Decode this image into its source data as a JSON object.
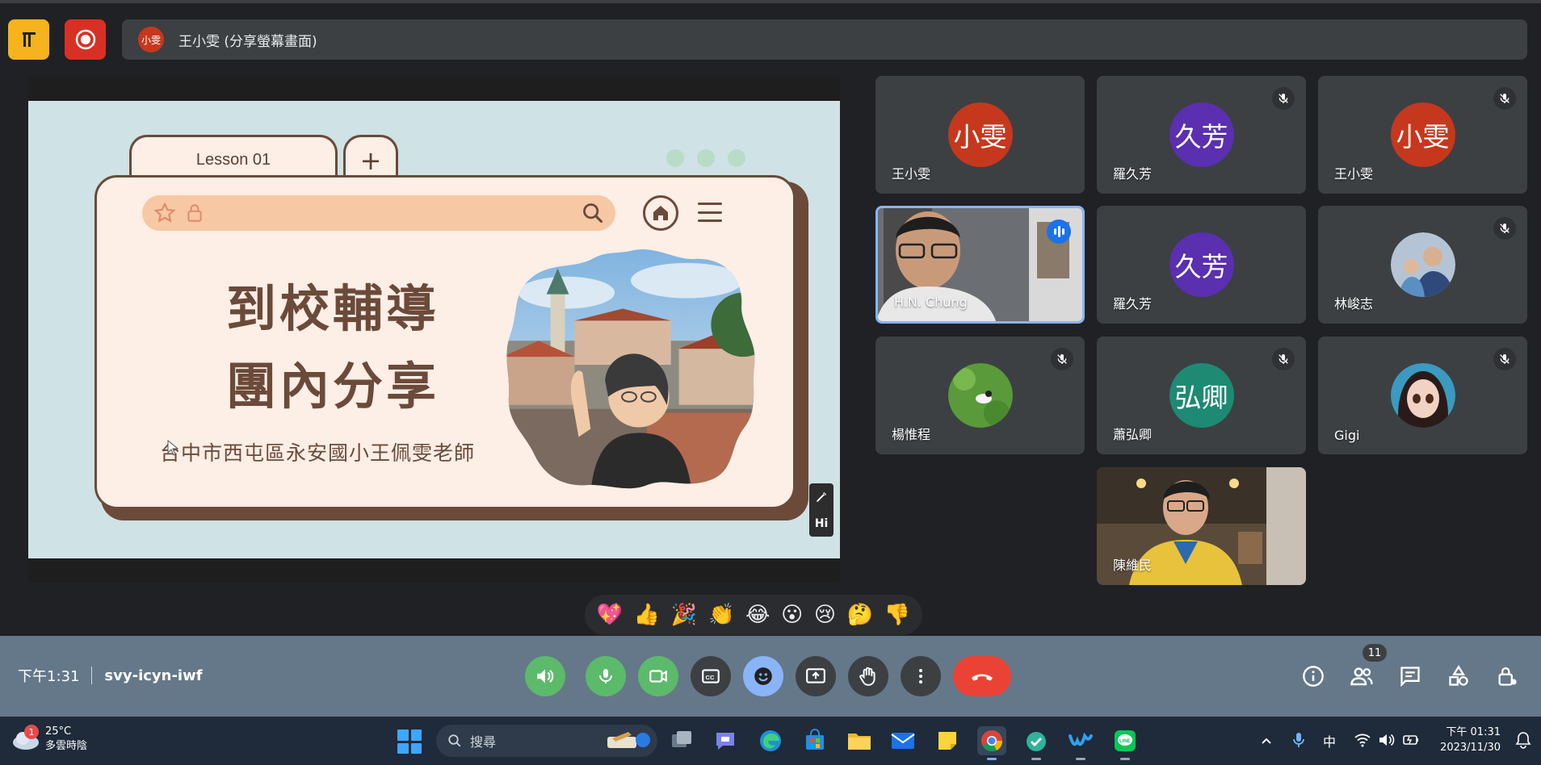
{
  "top_bar": {
    "presenter_avatar_text": "小雯",
    "presenter_label": "王小雯 (分享螢幕畫面)"
  },
  "slide": {
    "tab_label": "Lesson 01",
    "tab_add": "+",
    "title_line1": "到校輔導",
    "title_line2": "團內分享",
    "subtitle": "台中市西屯區永安國小王佩雯老師",
    "pen_label": "Hi"
  },
  "participants": [
    {
      "name": "王小雯",
      "initials": "小雯",
      "color": "#c5381d",
      "muted": false
    },
    {
      "name": "羅久芳",
      "initials": "久芳",
      "color": "#5a2fb0",
      "muted": true
    },
    {
      "name": "王小雯",
      "initials": "小雯",
      "color": "#c5381d",
      "muted": true
    },
    {
      "name": "H.N. Chung",
      "speaking": true
    },
    {
      "name": "羅久芳",
      "initials": "久芳",
      "color": "#5a2fb0",
      "muted": false
    },
    {
      "name": "林峻志",
      "muted": true
    },
    {
      "name": "楊惟程",
      "muted": true
    },
    {
      "name": "蕭弘卿",
      "initials": "弘卿",
      "color": "#1e8a74",
      "muted": true
    },
    {
      "name": "Gigi",
      "muted": true
    },
    {
      "name": "陳維民"
    }
  ],
  "reactions": [
    "💖",
    "👍",
    "🎉",
    "👏",
    "😂",
    "😮",
    "😢",
    "🤔",
    "👎"
  ],
  "controls": {
    "time": "下午1:31",
    "meeting_code": "svy-icyn-iwf",
    "people_count": "11"
  },
  "taskbar": {
    "weather_badge": "1",
    "temperature": "25°C",
    "weather_desc": "多雲時陰",
    "search_placeholder": "搜尋",
    "ime": "中",
    "clock_time": "下午 01:31",
    "clock_date": "2023/11/30"
  }
}
